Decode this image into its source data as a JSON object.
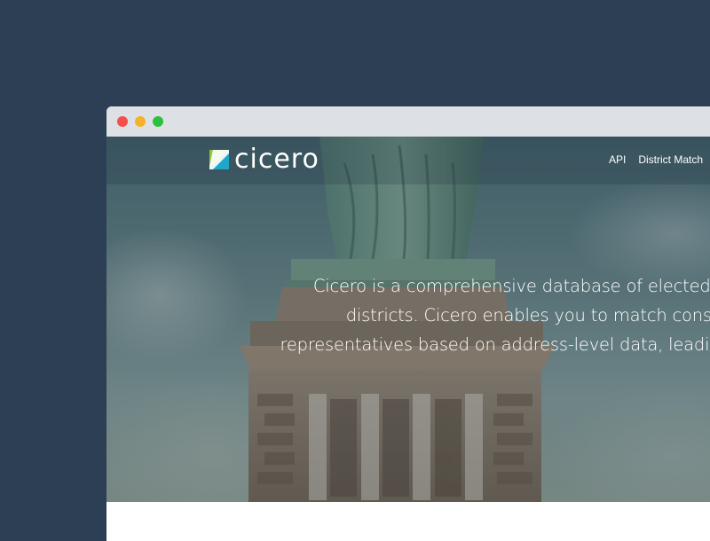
{
  "window": {
    "controls": [
      "close",
      "minimize",
      "maximize"
    ]
  },
  "navbar": {
    "logo_text": "cicero",
    "links": [
      {
        "label": "API"
      },
      {
        "label": "District Match"
      }
    ]
  },
  "hero": {
    "tagline_lines": [
      "Cicero is a comprehensive database of elected of",
      "districts. Cicero enables you to match constit",
      "representatives based on address-level data, leading"
    ]
  },
  "colors": {
    "background": "#2c3f55",
    "titlebar": "#dde1e6",
    "close": "#f2514b",
    "minimize": "#f6b12b",
    "maximize": "#2dc03e",
    "logo_accent_green": "#8cc63f",
    "logo_accent_teal": "#1fa7c9"
  },
  "icons": [
    "cicero-logo-icon"
  ]
}
